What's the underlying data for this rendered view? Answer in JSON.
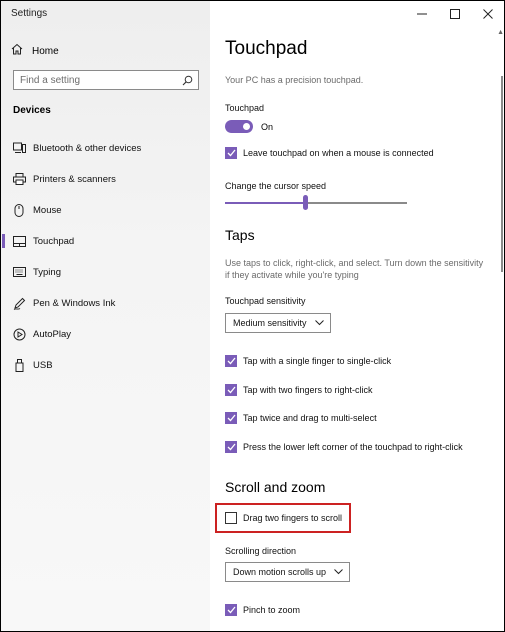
{
  "window": {
    "title": "Settings",
    "controls": {
      "minimize": "minimize-icon",
      "maximize": "maximize-icon",
      "close": "close-icon"
    }
  },
  "sidebar": {
    "home_label": "Home",
    "search_placeholder": "Find a setting",
    "section_title": "Devices",
    "items": [
      {
        "label": "Bluetooth & other devices",
        "icon": "bluetooth-devices-icon"
      },
      {
        "label": "Printers & scanners",
        "icon": "printer-icon"
      },
      {
        "label": "Mouse",
        "icon": "mouse-icon"
      },
      {
        "label": "Touchpad",
        "icon": "touchpad-icon",
        "active": true
      },
      {
        "label": "Typing",
        "icon": "keyboard-icon"
      },
      {
        "label": "Pen & Windows Ink",
        "icon": "pen-icon"
      },
      {
        "label": "AutoPlay",
        "icon": "autoplay-icon"
      },
      {
        "label": "USB",
        "icon": "usb-icon"
      }
    ]
  },
  "main": {
    "page_title": "Touchpad",
    "precision_text": "Your PC has a precision touchpad.",
    "touchpad_label": "Touchpad",
    "touchpad_toggle": {
      "state": "On",
      "on": true
    },
    "leave_on_checkbox": {
      "label": "Leave touchpad on when a mouse is connected",
      "checked": true
    },
    "cursor_speed": {
      "label": "Change the cursor speed",
      "value_fraction": 0.44
    },
    "taps": {
      "heading": "Taps",
      "description_line1": "Use taps to click, right-click, and select. Turn down the sensitivity",
      "description_line2": "if they activate while you're typing",
      "sensitivity_label": "Touchpad sensitivity",
      "sensitivity_value": "Medium sensitivity",
      "options": [
        {
          "label": "Tap with a single finger to single-click",
          "checked": true
        },
        {
          "label": "Tap with two fingers to right-click",
          "checked": true
        },
        {
          "label": "Tap twice and drag to multi-select",
          "checked": true
        },
        {
          "label": "Press the lower left corner of the touchpad to right-click",
          "checked": true
        }
      ]
    },
    "scroll_zoom": {
      "heading": "Scroll and zoom",
      "drag_two_fingers": {
        "label": "Drag two fingers to scroll",
        "checked": false
      },
      "direction_label": "Scrolling direction",
      "direction_value": "Down motion scrolls up",
      "pinch_to_zoom": {
        "label": "Pinch to zoom",
        "checked": true
      }
    }
  },
  "colors": {
    "accent": "#7a5cb8",
    "highlight": "#cc2222"
  }
}
